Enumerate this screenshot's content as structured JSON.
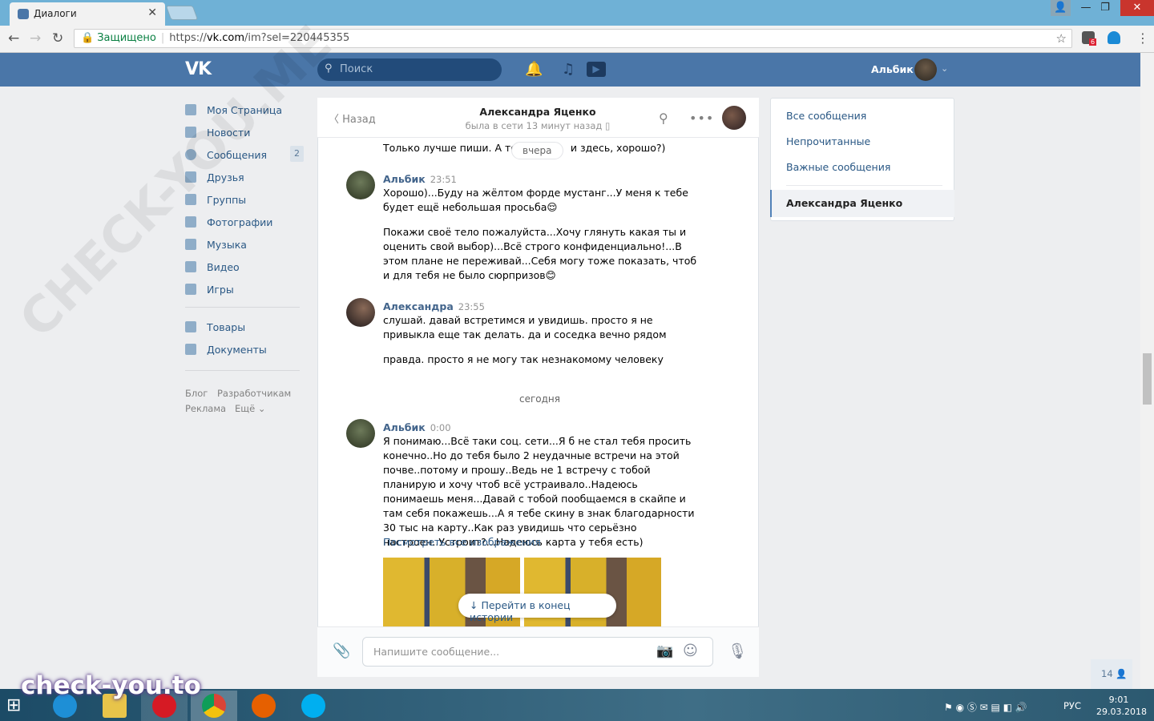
{
  "browser": {
    "tab_title": "Диалоги",
    "secure_label": "Защищено",
    "url_prefix": "https://",
    "url_host": "vk.com",
    "url_path": "/im?sel=220445355",
    "extension_badge": "6",
    "win_user_icon": "user-icon",
    "win_min": "—",
    "win_max": "❐",
    "win_close": "✕"
  },
  "header": {
    "logo": "VK",
    "search_placeholder": "Поиск",
    "user_name": "Альбик"
  },
  "sidebar": {
    "items": [
      {
        "label": "Моя Страница"
      },
      {
        "label": "Новости"
      },
      {
        "label": "Сообщения",
        "badge": "2"
      },
      {
        "label": "Друзья"
      },
      {
        "label": "Группы"
      },
      {
        "label": "Фотографии"
      },
      {
        "label": "Музыка"
      },
      {
        "label": "Видео"
      },
      {
        "label": "Игры"
      }
    ],
    "items2": [
      {
        "label": "Товары"
      },
      {
        "label": "Документы"
      }
    ],
    "footer": {
      "blog": "Блог",
      "dev": "Разработчикам",
      "ads": "Реклама",
      "more": "Ещё ⌄"
    }
  },
  "chat": {
    "back": "Назад",
    "name": "Александра Яценко",
    "status": "была в сети 13 минут назад",
    "top_line": "Только лучше пиши. А то л",
    "top_line_end": "и здесь, хорошо?)",
    "date_yesterday": "вчера",
    "date_today": "сегодня",
    "messages": [
      {
        "author": "Альбик",
        "time": "23:51",
        "p1": "Хорошо)...Буду на жёлтом форде мустанг...У меня к тебе будет ещё небольшая просьба😌",
        "p2": "Покажи своё тело пожалуйста...Хочу глянуть какая ты и оценить свой выбор)...Всё строго конфиденциально!...В этом плане не переживай...Себя могу тоже показать, чтоб и для тебя не было сюрпризов😊"
      },
      {
        "author": "Александра",
        "time": "23:55",
        "p1": "слушай. давай встретимся и увидишь. просто я не привыкла еще так делать. да и соседка вечно рядом",
        "p2": "правда. просто я не могу так незнакомому человеку"
      },
      {
        "author": "Альбик",
        "time": "0:00",
        "p1": "Я понимаю...Всё таки соц. сети...Я б не стал тебя просить конечно..Но до тебя было 2 неудачные встречи на этой почве..потому и прошу..Ведь не 1 встречу с тобой планирую и хочу чтоб всё устраивало..Надеюсь понимаешь меня...Давай с тобой пообщаемся в скайпе и там себя покажешь...А я тебе скину в знак благодарности 30 тыс на карту..Как раз увидишь что серьёзно настроен..Устроит?...Надеюсь карта у тебя есть)",
        "link": "Посмотреть все изображения"
      }
    ],
    "goto_end": "Перейти в конец истории",
    "compose_placeholder": "Напишите сообщение..."
  },
  "right_panel": {
    "all": "Все сообщения",
    "unread": "Непрочитанные",
    "important": "Важные сообщения",
    "active": "Александра Яценко"
  },
  "online_count": "14",
  "taskbar": {
    "lang": "РУС",
    "time": "9:01",
    "date": "29.03.2018"
  },
  "watermarks": {
    "diag": "CHECK-YOU.ME",
    "site": "check-you.to"
  },
  "colors": {
    "vk_blue": "#4a76a8",
    "link": "#2a5885"
  }
}
